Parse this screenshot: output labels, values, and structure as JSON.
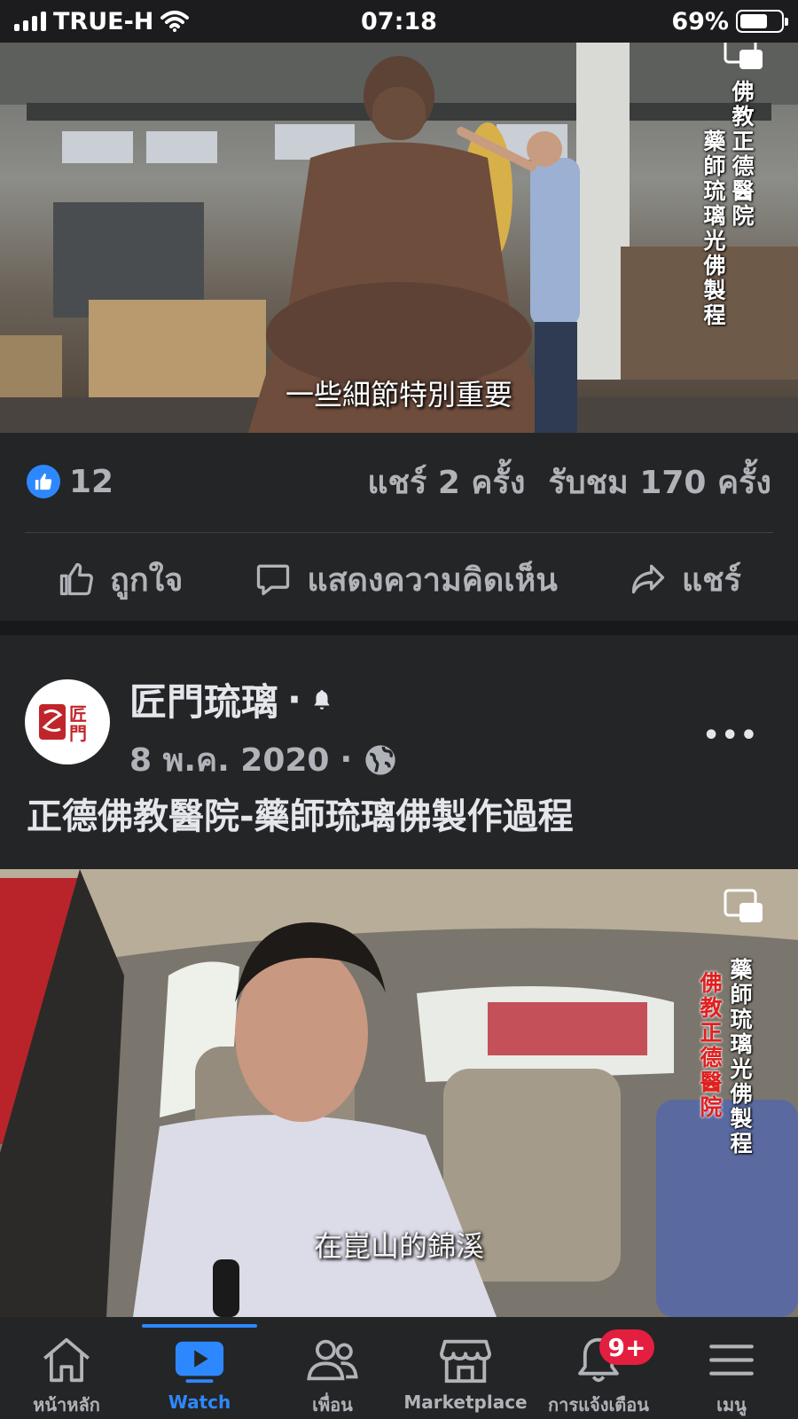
{
  "status_bar": {
    "carrier": "TRUE-H",
    "time": "07:18",
    "battery": "69%",
    "battery_level": 0.69
  },
  "video1": {
    "subtitle": "一些細節特別重要",
    "side_text_right": "佛教正德醫院",
    "side_text_left": "藥師琉璃光佛製程"
  },
  "reactions": {
    "like_count": "12",
    "shares": "แชร์ 2 ครั้ง",
    "views": "รับชม 170 ครั้ง",
    "like_label": "ถูกใจ",
    "comment_label": "แสดงความคิดเห็น",
    "share_label": "แชร์"
  },
  "post": {
    "page_name": "匠門琉璃",
    "date": "8 พ.ค. 2020",
    "title": "正德佛教醫院-藥師琉璃佛製作過程",
    "avatar_text": "匠門"
  },
  "video2": {
    "subtitle": "在崑山的錦溪",
    "side_text_red": "佛教正德醫院",
    "side_text_white": "藥師琉璃光佛製程"
  },
  "bottom_nav": {
    "items": [
      {
        "label": "หน้าหลัก",
        "icon": "home-icon"
      },
      {
        "label": "Watch",
        "icon": "watch-icon"
      },
      {
        "label": "เพื่อน",
        "icon": "friends-icon"
      },
      {
        "label": "Marketplace",
        "icon": "marketplace-icon"
      },
      {
        "label": "การแจ้งเตือน",
        "icon": "bell-icon"
      },
      {
        "label": "เมนู",
        "icon": "menu-icon"
      }
    ],
    "notification_badge": "9+",
    "active_index": 1
  },
  "colors": {
    "accent": "#2d88ff",
    "badge": "#e41e3f",
    "surface": "#242526",
    "background": "#18191a"
  }
}
